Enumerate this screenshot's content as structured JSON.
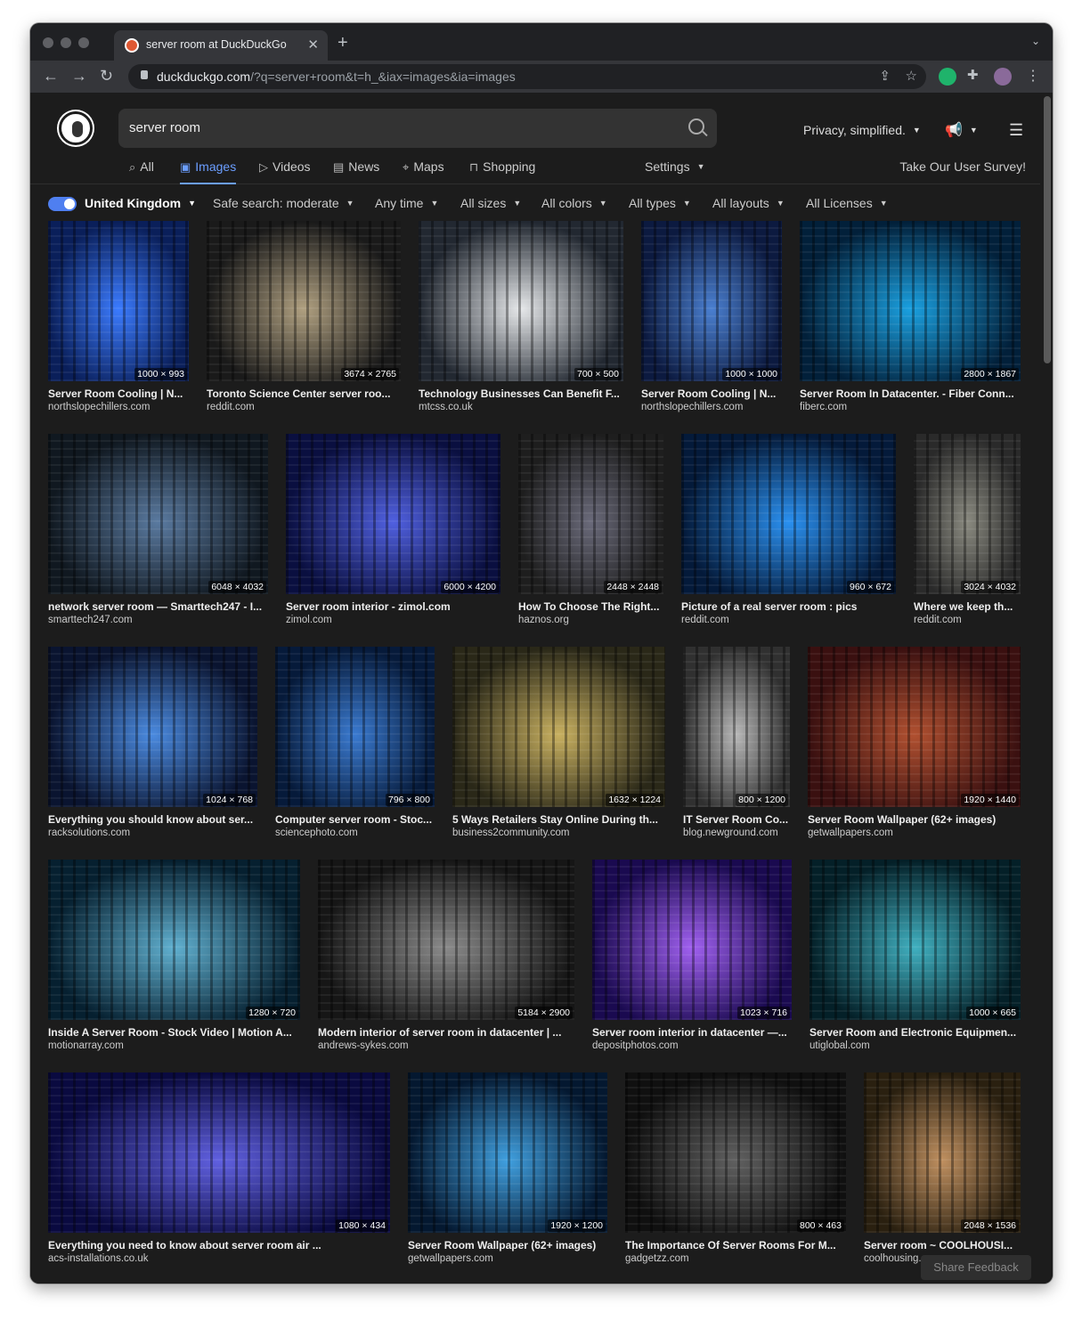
{
  "browser": {
    "tab_title": "server room at DuckDuckGo",
    "url_host": "duckduckgo.com",
    "url_path": "/?q=server+room&t=h_&iax=images&ia=images"
  },
  "header": {
    "search_value": "server room",
    "privacy_label": "Privacy, simplified.",
    "settings_label": "Settings",
    "survey_label": "Take Our User Survey!"
  },
  "nav_tabs": [
    {
      "label": "All",
      "icon": "search-icon"
    },
    {
      "label": "Images",
      "icon": "image-icon",
      "active": true
    },
    {
      "label": "Videos",
      "icon": "play-icon"
    },
    {
      "label": "News",
      "icon": "newspaper-icon"
    },
    {
      "label": "Maps",
      "icon": "map-pin-icon"
    },
    {
      "label": "Shopping",
      "icon": "shopping-bag-icon"
    }
  ],
  "filters": {
    "region": "United Kingdom",
    "safe_search": "Safe search: moderate",
    "time": "Any time",
    "sizes": "All sizes",
    "colors": "All colors",
    "types": "All types",
    "layouts": "All layouts",
    "licenses": "All Licenses"
  },
  "results": [
    {
      "title": "Server Room Cooling | N...",
      "domain": "northslopechillers.com",
      "dims": "1000 × 993",
      "c1": "#0a1f5a",
      "c2": "#3b7bff"
    },
    {
      "title": "Toronto Science Center server roo...",
      "domain": "reddit.com",
      "dims": "3674 × 2765",
      "c1": "#1a1a1a",
      "c2": "#b0a080"
    },
    {
      "title": "Technology Businesses Can Benefit F...",
      "domain": "mtcss.co.uk",
      "dims": "700 × 500",
      "c1": "#222831",
      "c2": "#e6e8ea"
    },
    {
      "title": "Server Room Cooling | N...",
      "domain": "northslopechillers.com",
      "dims": "1000 × 1000",
      "c1": "#0c1a40",
      "c2": "#4a7fd0"
    },
    {
      "title": "Server Room In Datacenter. - Fiber Conn...",
      "domain": "fiberc.com",
      "dims": "2800 × 1867",
      "c1": "#02203a",
      "c2": "#1aa0e0"
    },
    {
      "title": "network server room — Smarttech247 - I...",
      "domain": "smarttech247.com",
      "dims": "6048 × 4032",
      "c1": "#101820",
      "c2": "#5a7aa0"
    },
    {
      "title": "Server room interior - zimol.com",
      "domain": "zimol.com",
      "dims": "6000 × 4200",
      "c1": "#0a0f40",
      "c2": "#5060e0"
    },
    {
      "title": "How To Choose The Right...",
      "domain": "haznos.org",
      "dims": "2448 × 2448",
      "c1": "#1e1e1e",
      "c2": "#6a6a7a"
    },
    {
      "title": "Picture of a real server room : pics",
      "domain": "reddit.com",
      "dims": "960 × 672",
      "c1": "#041a3a",
      "c2": "#2a90f0"
    },
    {
      "title": "Where we keep th...",
      "domain": "reddit.com",
      "dims": "3024 × 4032",
      "c1": "#2a2a2a",
      "c2": "#8a8a80"
    },
    {
      "title": "Everything you should know about ser...",
      "domain": "racksolutions.com",
      "dims": "1024 × 768",
      "c1": "#0a1430",
      "c2": "#4a8ae0"
    },
    {
      "title": "Computer server room - Stoc...",
      "domain": "sciencephoto.com",
      "dims": "796 × 800",
      "c1": "#061a3a",
      "c2": "#3a7ad0"
    },
    {
      "title": "5 Ways Retailers Stay Online During th...",
      "domain": "business2community.com",
      "dims": "1632 × 1224",
      "c1": "#2a2818",
      "c2": "#c8b060"
    },
    {
      "title": "IT Server Room Co...",
      "domain": "blog.newground.com",
      "dims": "800 × 1200",
      "c1": "#303030",
      "c2": "#b8b8b8"
    },
    {
      "title": "Server Room Wallpaper (62+ images)",
      "domain": "getwallpapers.com",
      "dims": "1920 × 1440",
      "c1": "#3a1010",
      "c2": "#b05030"
    },
    {
      "title": "Inside A Server Room - Stock Video | Motion A...",
      "domain": "motionarray.com",
      "dims": "1280 × 720",
      "c1": "#062030",
      "c2": "#60b0d0"
    },
    {
      "title": "Modern interior of server room in datacenter | ...",
      "domain": "andrews-sykes.com",
      "dims": "5184 × 2900",
      "c1": "#161616",
      "c2": "#8a8a8a"
    },
    {
      "title": "Server room interior in datacenter —...",
      "domain": "depositphotos.com",
      "dims": "1023 × 716",
      "c1": "#1a0a50",
      "c2": "#a060f0"
    },
    {
      "title": "Server Room and Electronic Equipmen...",
      "domain": "utiglobal.com",
      "dims": "1000 × 665",
      "c1": "#042028",
      "c2": "#40b0c0"
    },
    {
      "title": "Everything you need to know about server room air ...",
      "domain": "acs-installations.co.uk",
      "dims": "1080 × 434",
      "c1": "#0a0a40",
      "c2": "#6060e0"
    },
    {
      "title": "Server Room Wallpaper (62+ images)",
      "domain": "getwallpapers.com",
      "dims": "1920 × 1200",
      "c1": "#041830",
      "c2": "#40a0e0"
    },
    {
      "title": "The Importance Of Server Rooms For M...",
      "domain": "gadgetzz.com",
      "dims": "800 × 463",
      "c1": "#101010",
      "c2": "#606060"
    },
    {
      "title": "Server room ~ COOLHOUSI...",
      "domain": "coolhousing...",
      "dims": "2048 × 1536",
      "c1": "#2a2010",
      "c2": "#c09060"
    }
  ],
  "feedback_label": "Share Feedback"
}
